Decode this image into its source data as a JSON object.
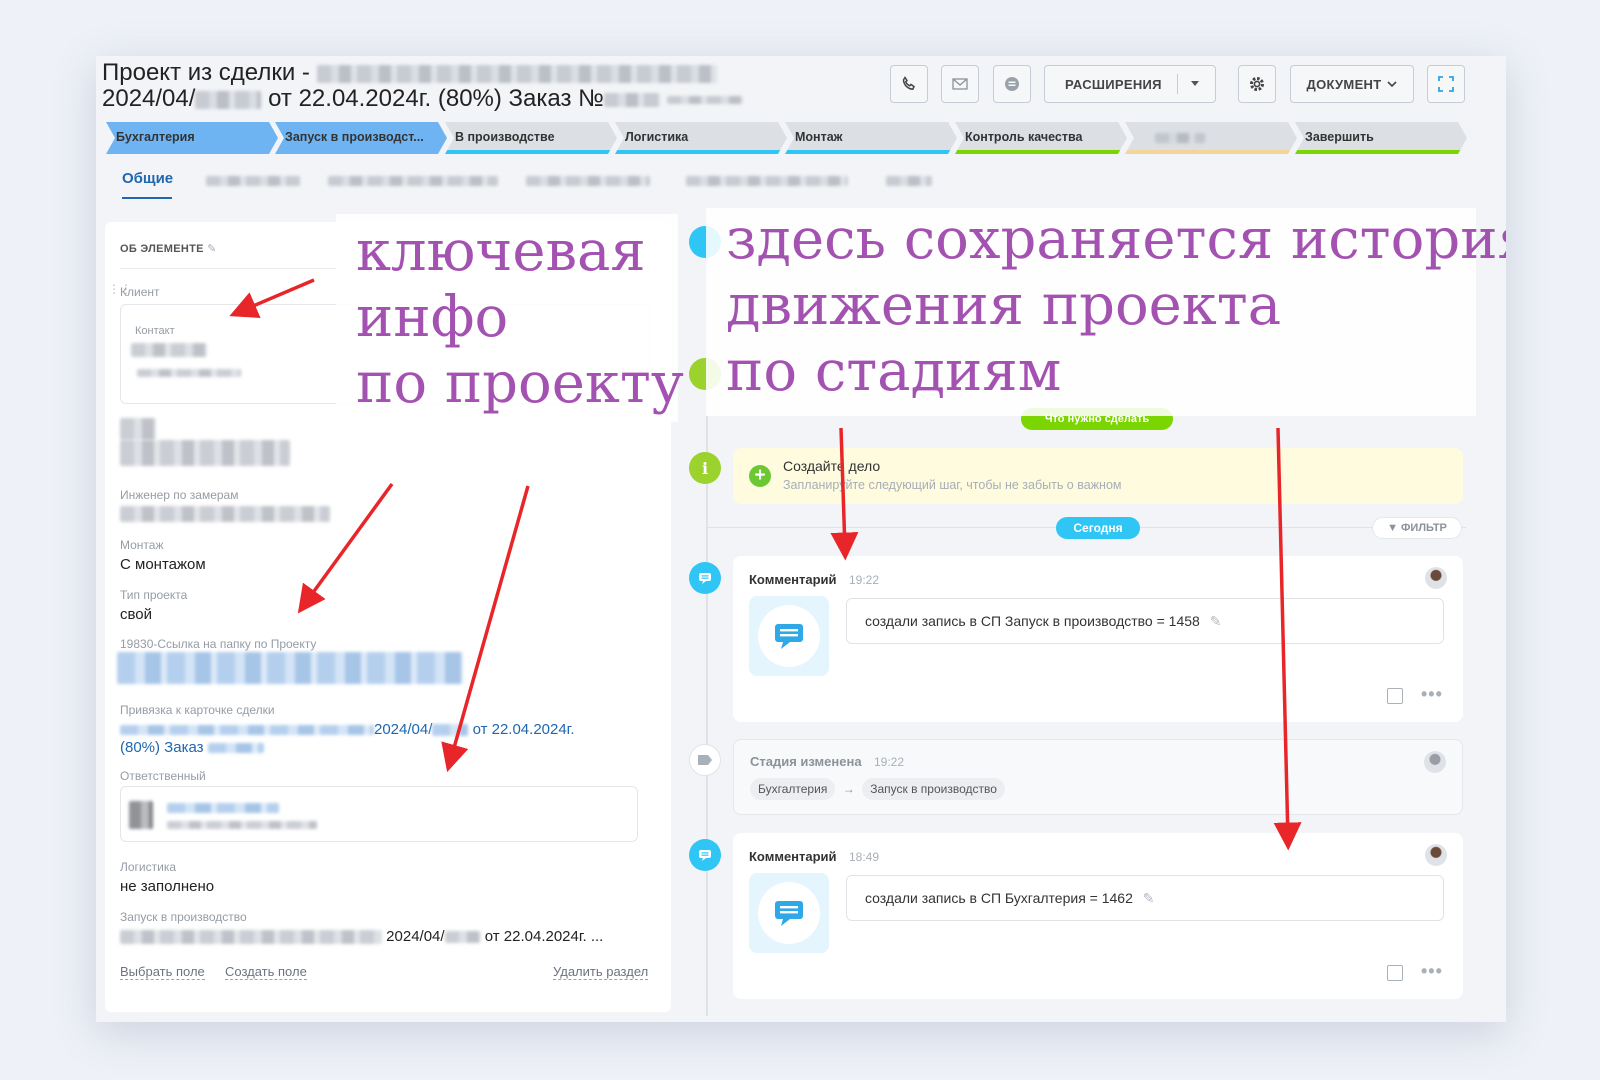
{
  "header": {
    "title_line1": "Проект из сделки -",
    "title_line2_a": "2024/04/",
    "title_line2_b": "от 22.04.2024г. (80%) Заказ №",
    "buttons": {
      "extensions": "РАСШИРЕНИЯ",
      "document": "ДОКУМЕНТ"
    }
  },
  "stages": [
    {
      "label": "Бухгалтерия",
      "color": "#6fb4f2",
      "underline": "#6fb4f2"
    },
    {
      "label": "Запуск в производст...",
      "color": "#6fb4f2",
      "underline": "#6fb4f2"
    },
    {
      "label": "В производстве",
      "color": "#dcdfe3",
      "underline": "#2fc6f6"
    },
    {
      "label": "Логистика",
      "color": "#dcdfe3",
      "underline": "#2fc6f6"
    },
    {
      "label": "Монтаж",
      "color": "#dcdfe3",
      "underline": "#2fc6f6"
    },
    {
      "label": "Контроль качества",
      "color": "#dcdfe3",
      "underline": "#7bd500"
    },
    {
      "label": "",
      "color": "#dcdfe3",
      "underline": "#f3d49a"
    },
    {
      "label": "Завершить",
      "color": "#dcdfe3",
      "underline": "#7bd500"
    }
  ],
  "tabs": {
    "active": "Общие"
  },
  "about": {
    "section_title": "ОБ ЭЛЕМЕНТЕ",
    "client_label": "Клиент",
    "contact_label": "Контакт",
    "engineer_label": "Инженер по замерам",
    "montage_label": "Монтаж",
    "montage_value": "С монтажом",
    "project_type_label": "Тип проекта",
    "project_type_value": "свой",
    "folder_link_label": "19830-Ссылка на папку по Проекту",
    "deal_link_label": "Привязка к карточке сделки",
    "deal_link_a": "2024/04/",
    "deal_link_b": "от 22.04.2024г.",
    "deal_link_c": "(80%) Заказ",
    "responsible_label": "Ответственный",
    "logistics_label": "Логистика",
    "logistics_value": "не заполнено",
    "launch_label": "Запуск в производство",
    "launch_value_a": "2024/04/",
    "launch_value_b": "от 22.04.2024г. ...",
    "select_field": "Выбрать поле",
    "create_field": "Создать поле",
    "delete_section": "Удалить раздел"
  },
  "annotations": {
    "left": [
      "ключевая",
      "инфо",
      "по проекту"
    ],
    "right": [
      "здесь сохраняется история",
      "движения проекта",
      "по стадиям"
    ]
  },
  "timeline": {
    "todo_pill": "Что нужно сделать",
    "create_task_title": "Создайте дело",
    "create_task_sub": "Запланируйте следующий шаг, чтобы не забыть о важном",
    "today_pill": "Сегодня",
    "filter": "ФИЛЬТР",
    "items": [
      {
        "title": "Комментарий",
        "time": "19:22",
        "text": "создали запись в СП Запуск в производство = 1458"
      },
      {
        "title": "Стадия изменена",
        "time": "19:22",
        "from": "Бухгалтерия",
        "to": "Запуск в производство"
      },
      {
        "title": "Комментарий",
        "time": "18:49",
        "text": "создали запись в СП Бухгалтерия = 1462"
      }
    ]
  },
  "colors": {
    "accent": "#2067b0",
    "timeline_blue": "#2fc6f6",
    "green": "#7bd500",
    "annotation": "#a452b2",
    "arrow": "#e8262a"
  }
}
